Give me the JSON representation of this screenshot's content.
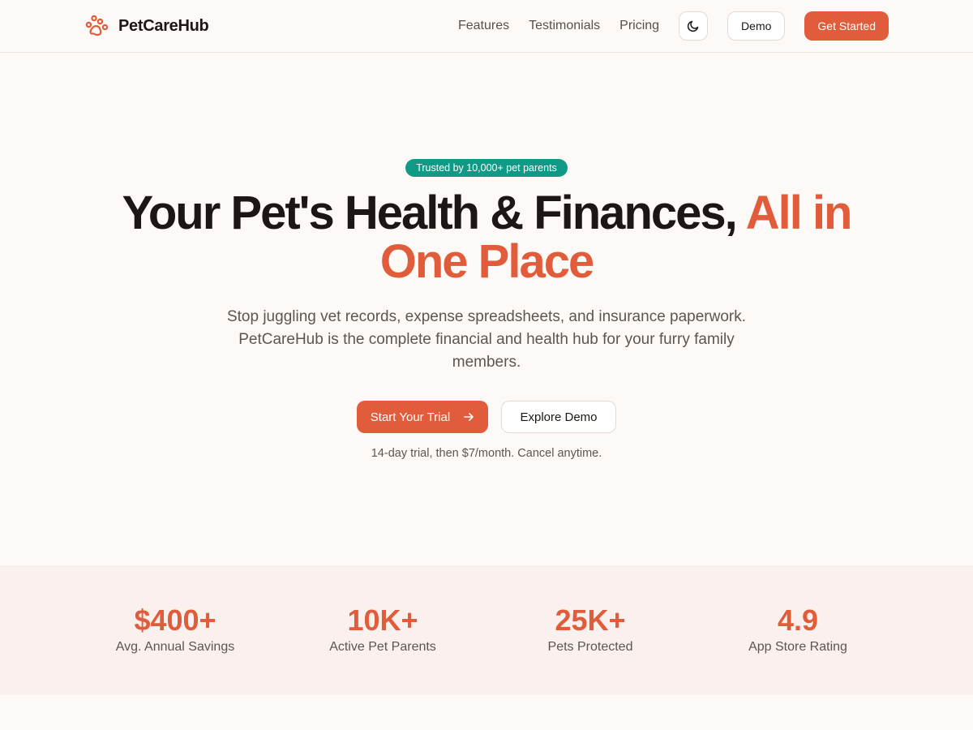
{
  "brand": {
    "name": "PetCareHub",
    "icon": "paw-icon",
    "accent_color": "#e15c3a"
  },
  "nav": {
    "links": [
      "Features",
      "Testimonials",
      "Pricing"
    ],
    "theme_toggle_icon": "moon-icon",
    "demo_label": "Demo",
    "get_started_label": "Get Started"
  },
  "hero": {
    "badge": "Trusted by 10,000+ pet parents",
    "headline_main": "Your Pet's Health & Finances, ",
    "headline_accent": "All in One Place",
    "subtext": "Stop juggling vet records, expense spreadsheets, and insurance paperwork. PetCareHub is the complete financial and health hub for your furry family members.",
    "primary_cta": "Start Your Trial",
    "primary_cta_icon": "arrow-right-icon",
    "secondary_cta": "Explore Demo",
    "fineprint": "14-day trial, then $7/month. Cancel anytime."
  },
  "stats": [
    {
      "value": "$400+",
      "label": "Avg. Annual Savings"
    },
    {
      "value": "10K+",
      "label": "Active Pet Parents"
    },
    {
      "value": "25K+",
      "label": "Pets Protected"
    },
    {
      "value": "4.9",
      "label": "App Store Rating"
    }
  ],
  "colors": {
    "primary": "#e15c3a",
    "badge": "#109a86",
    "background": "#fdf9f7",
    "stats_background": "#faf1ee"
  }
}
